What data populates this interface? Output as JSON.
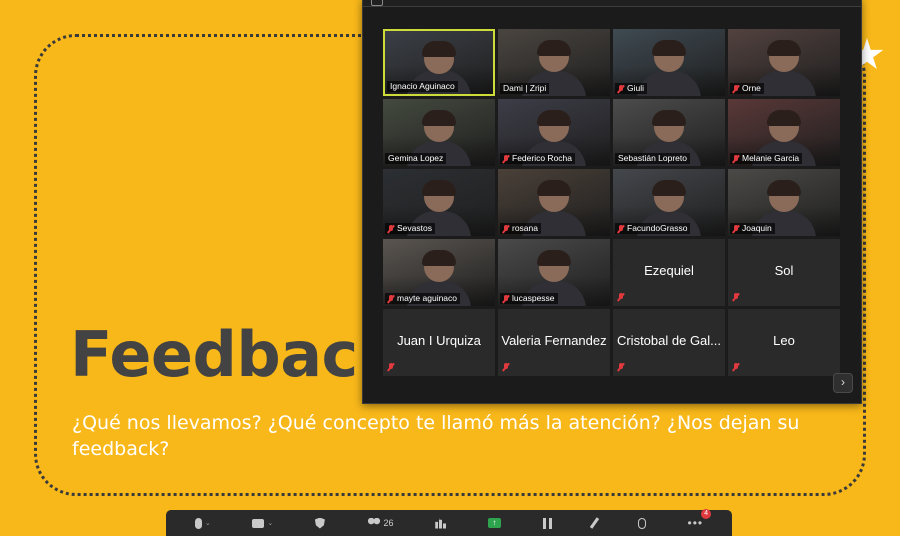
{
  "slide": {
    "title": "Feedback",
    "subtitle": "¿Qué nos llevamos? ¿Qué concepto te llamó más la atención? ¿Nos dejan su feedback?",
    "background_color": "#F8B81A"
  },
  "zoom": {
    "participants": [
      {
        "name": "Ignacio Aguinaco",
        "video": true,
        "muted": false,
        "active": true
      },
      {
        "name": "Dami | Zripi",
        "video": true,
        "muted": false,
        "active": false
      },
      {
        "name": "Giuli",
        "video": true,
        "muted": true,
        "active": false
      },
      {
        "name": "Orne",
        "video": true,
        "muted": true,
        "active": false
      },
      {
        "name": "Gemina Lopez",
        "video": true,
        "muted": false,
        "active": false
      },
      {
        "name": "Federico Rocha",
        "video": true,
        "muted": true,
        "active": false
      },
      {
        "name": "Sebastián Lopreto",
        "video": true,
        "muted": false,
        "active": false
      },
      {
        "name": "Melanie Garcia",
        "video": true,
        "muted": true,
        "active": false
      },
      {
        "name": "Sevastos",
        "video": true,
        "muted": true,
        "active": false
      },
      {
        "name": "rosana",
        "video": true,
        "muted": true,
        "active": false
      },
      {
        "name": "FacundoGrasso",
        "video": true,
        "muted": true,
        "active": false
      },
      {
        "name": "Joaquin",
        "video": true,
        "muted": true,
        "active": false
      },
      {
        "name": "mayte aguinaco",
        "video": true,
        "muted": true,
        "active": false
      },
      {
        "name": "lucaspesse",
        "video": true,
        "muted": true,
        "active": false
      },
      {
        "name": "Ezequiel",
        "video": false,
        "muted": true,
        "active": false
      },
      {
        "name": "Sol",
        "video": false,
        "muted": true,
        "active": false
      },
      {
        "name": "Juan I Urquiza",
        "video": false,
        "muted": true,
        "active": false
      },
      {
        "name": "Valeria Fernandez",
        "video": false,
        "muted": true,
        "active": false
      },
      {
        "name": "Cristobal de Gal...",
        "video": false,
        "muted": true,
        "active": false
      },
      {
        "name": "Leo",
        "video": false,
        "muted": true,
        "active": false
      }
    ],
    "next_page_icon": "chevron-right-icon"
  },
  "toolbar": {
    "participants_count": "26",
    "chat_badge": "4",
    "share_icon": "up-arrow-icon",
    "more_label": "•••",
    "caret": "⌄"
  },
  "colors": {
    "accent": "#F8B81A",
    "title_text": "#434343",
    "active_speaker_border": "#cddc39",
    "muted_red": "#e0393e",
    "share_green": "#2ea44f"
  }
}
